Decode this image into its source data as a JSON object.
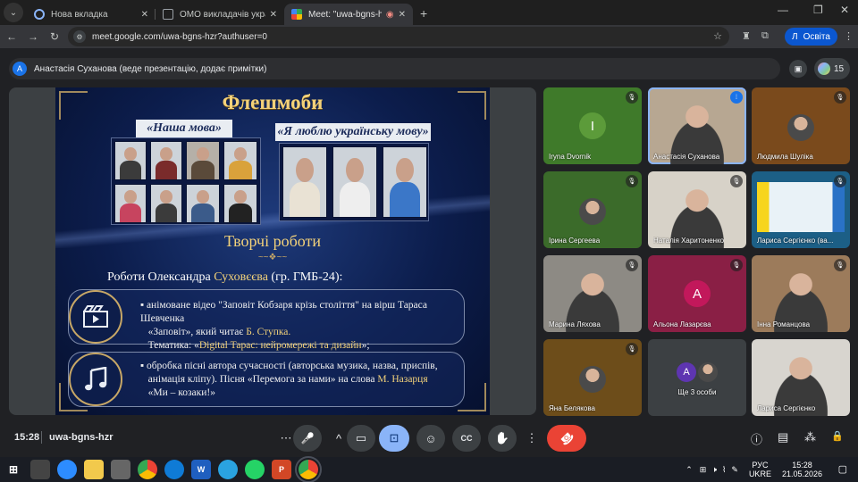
{
  "browser": {
    "tabs": [
      {
        "title": "Нова вкладка",
        "icon": "globe-icon",
        "color": "#8ab4f8"
      },
      {
        "title": "ОМО викладачів української",
        "icon": "page-icon",
        "color": "#9aa0a6"
      },
      {
        "title": "Meet: \"uwa-bgns-hzr\"",
        "icon": "meet-icon",
        "color": "#34a853",
        "active": true
      }
    ],
    "new_tab": "+",
    "window_controls": {
      "minimize": "—",
      "maximize": "❐",
      "close": "✕"
    },
    "nav": {
      "back": "←",
      "forward": "→",
      "reload": "↻"
    },
    "url": "meet.google.com/uwa-bgns-hzr?authuser=0",
    "profile_initial": "Л",
    "profile_label": "Освіта"
  },
  "meet": {
    "presenter_initial": "А",
    "presenter_text": "Анастасія Суханова (веде презентацію, додає примітки)",
    "participants_count": "15",
    "clock": "15:28",
    "meeting_code": "uwa-bgns-hzr"
  },
  "slide": {
    "title": "Флешмоби",
    "pill_left": "«Наша мова»",
    "pill_right": "«Я люблю українську мову»",
    "subtitle": "Творчі роботи",
    "ornament": "~~❖~~",
    "author_prefix": "Роботи Олександра ",
    "author_name": "Суховєєва",
    "author_suffix": " (гр. ГМБ-24):",
    "item1": {
      "line1": "анімоване відео \"Заповіт Кобзаря крізь століття\" на вірш Тараса Шевченка",
      "line2_prefix": "«Заповіт», який читає ",
      "line2_gold": "Б. Ступка.",
      "line3_prefix": "Тематика: «",
      "line3_gold": "Digital Тарас: нейромережі та дизайн",
      "line3_suffix": "»;"
    },
    "item2": {
      "line1": "обробка пісні автора сучасності (авторська музика, назва, приспів,",
      "line2_prefix": "анімація кліпу). Пісня «Перемога за нами» на слова ",
      "line2_gold": "М. Назарця",
      "line3": "«Ми – козаки!»"
    }
  },
  "tiles": [
    {
      "name": "Iryna Dvornik",
      "type": "avatar",
      "initial": "I",
      "bg": "#3f7a2a",
      "av": "#5c9b3a",
      "muted": true
    },
    {
      "name": "Анастасія Суханова",
      "type": "video",
      "bg": "#b7a792",
      "speaking": true,
      "muted": false
    },
    {
      "name": "Людмила Шуліка",
      "type": "small",
      "bg": "#7a4a1c",
      "muted": true
    },
    {
      "name": "Ірина Сергеева",
      "type": "small",
      "bg": "#3b6b2a",
      "muted": true
    },
    {
      "name": "Наталія Харитоненко",
      "type": "video",
      "bg": "#d7d2c8",
      "muted": true
    },
    {
      "name": "Лариса Сергієнко (ва...",
      "type": "screen",
      "bg": "#1c5f86",
      "muted": true
    },
    {
      "name": "Марина Ляхова",
      "type": "video",
      "bg": "#8d8a84",
      "muted": true
    },
    {
      "name": "Альона Лазарєва",
      "type": "avatar",
      "initial": "А",
      "bg": "#8a1f45",
      "av": "#c2185b",
      "muted": true
    },
    {
      "name": "Інна Романцова",
      "type": "video",
      "bg": "#9c7b5b",
      "muted": true
    },
    {
      "name": "Яна Белякова",
      "type": "small",
      "bg": "#6d4d1a",
      "muted": true
    },
    {
      "name": "Ще 3 особи",
      "type": "more",
      "initial": "А",
      "bg": "#3c4043",
      "av": "#5e35b1"
    },
    {
      "name": "Лариса Сергієнко",
      "type": "video",
      "bg": "#d8d5cf",
      "muted": false
    }
  ],
  "controls": {
    "more_left": "⋯",
    "mic": "🎤",
    "chevron": "^",
    "camera": "▭",
    "present": "⊡",
    "emoji": "☺",
    "captions": "CC",
    "raise_hand": "✋",
    "more": "⋮",
    "end_call": "☎",
    "info": "ⓘ",
    "chat": "▤",
    "activities": "⁂",
    "lock": "🔒"
  },
  "taskbar": {
    "start": "⊞",
    "lang_top": "РУС",
    "lang_bottom": "UKRE",
    "time": "15:28",
    "date": "21.05.2026"
  }
}
